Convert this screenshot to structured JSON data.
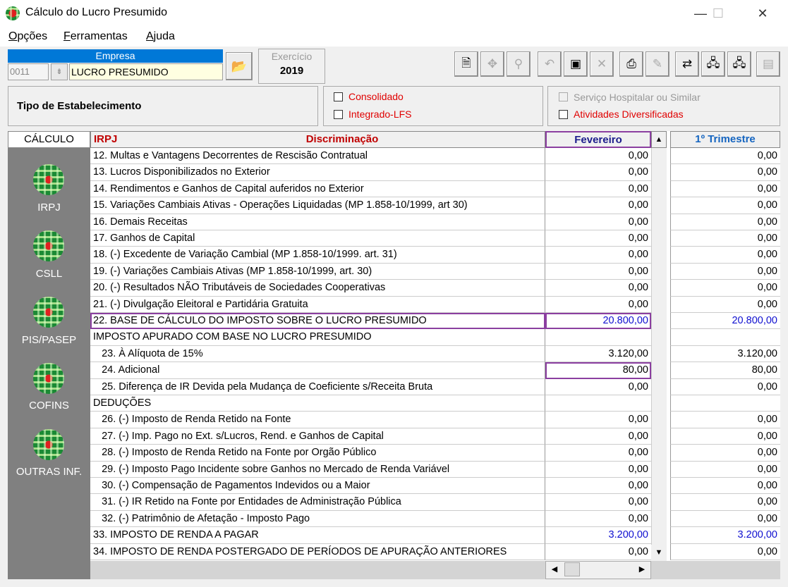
{
  "window": {
    "title": "Cálculo do Lucro Presumido",
    "controls": {
      "minimize": "—",
      "maximize": "☐",
      "close": "✕"
    }
  },
  "menu": [
    {
      "label": "Opções",
      "underline": "O"
    },
    {
      "label": "Ferramentas",
      "underline": "F"
    },
    {
      "label": "Ajuda",
      "underline": "A"
    }
  ],
  "empresa": {
    "label": "Empresa",
    "code": "0011",
    "name": "LUCRO PRESUMIDO"
  },
  "exercicio": {
    "label": "Exercício",
    "year": "2019"
  },
  "toolbar_icons": [
    "document-icon",
    "navigate-icon",
    "search-icon",
    "undo-icon",
    "save-icon",
    "delete-icon",
    "print-icon",
    "tools-icon",
    "import-icon",
    "network-icon",
    "network-config-icon",
    "calculator-icon"
  ],
  "establishment": {
    "label": "Tipo de Estabelecimento",
    "checkboxes": [
      {
        "label": "Consolidado",
        "checked": false,
        "enabled": true
      },
      {
        "label": "Integrado-LFS",
        "checked": false,
        "enabled": true
      },
      {
        "label": "Serviço Hospitalar ou Similar",
        "checked": false,
        "enabled": false
      },
      {
        "label": "Atividades Diversificadas",
        "checked": false,
        "enabled": true
      }
    ]
  },
  "sidebar": {
    "header": "CÁLCULO",
    "items": [
      "IRPJ",
      "CSLL",
      "PIS/PASEP",
      "COFINS",
      "OUTRAS INF."
    ]
  },
  "grid": {
    "headers": {
      "tax": "IRPJ",
      "description": "Discriminação",
      "month": "Fevereiro",
      "quarter": "1º Trimestre"
    },
    "rows": [
      {
        "desc": "12. Multas e Vantagens Decorrentes de Rescisão Contratual",
        "month": "0,00",
        "quarter": "0,00"
      },
      {
        "desc": "13. Lucros Disponibilizados no Exterior",
        "month": "0,00",
        "quarter": "0,00"
      },
      {
        "desc": "14. Rendimentos e Ganhos de Capital auferidos no Exterior",
        "month": "0,00",
        "quarter": "0,00"
      },
      {
        "desc": "15. Variações Cambiais Ativas - Operações Liquidadas (MP 1.858-10/1999, art 30)",
        "month": "0,00",
        "quarter": "0,00"
      },
      {
        "desc": "16. Demais Receitas",
        "month": "0,00",
        "quarter": "0,00"
      },
      {
        "desc": "17. Ganhos de Capital",
        "month": "0,00",
        "quarter": "0,00"
      },
      {
        "desc": "18. (-) Excedente de Variação Cambial (MP 1.858-10/1999. art. 31)",
        "month": "0,00",
        "quarter": "0,00"
      },
      {
        "desc": "19. (-) Variações Cambiais Ativas (MP 1.858-10/1999, art. 30)",
        "month": "0,00",
        "quarter": "0,00"
      },
      {
        "desc": "20. (-) Resultados NÃO Tributáveis de Sociedades Cooperativas",
        "month": "0,00",
        "quarter": "0,00"
      },
      {
        "desc": "21. (-) Divulgação Eleitoral e Partidária Gratuita",
        "month": "0,00",
        "quarter": "0,00"
      },
      {
        "desc": "22. BASE DE CÁLCULO DO IMPOSTO SOBRE O LUCRO PRESUMIDO",
        "month": "20.800,00",
        "quarter": "20.800,00",
        "blue": true,
        "highlight": "row"
      },
      {
        "desc": "IMPOSTO APURADO COM BASE NO LUCRO PRESUMIDO",
        "month": "",
        "quarter": ""
      },
      {
        "desc": "   23. À Alíquota de 15%",
        "month": "3.120,00",
        "quarter": "3.120,00"
      },
      {
        "desc": "   24. Adicional",
        "month": "80,00",
        "quarter": "80,00",
        "highlight": "cell"
      },
      {
        "desc": "   25. Diferença de IR Devida pela Mudança de Coeficiente s/Receita Bruta",
        "month": "0,00",
        "quarter": "0,00"
      },
      {
        "desc": "DEDUÇÕES",
        "month": "",
        "quarter": ""
      },
      {
        "desc": "   26. (-) Imposto de Renda Retido na Fonte",
        "month": "0,00",
        "quarter": "0,00"
      },
      {
        "desc": "   27. (-) Imp. Pago no Ext. s/Lucros, Rend. e Ganhos de Capital",
        "month": "0,00",
        "quarter": "0,00"
      },
      {
        "desc": "   28. (-) Imposto de Renda Retido na Fonte por Orgão Público",
        "month": "0,00",
        "quarter": "0,00"
      },
      {
        "desc": "   29. (-) Imposto Pago Incidente sobre Ganhos no Mercado de Renda Variável",
        "month": "0,00",
        "quarter": "0,00"
      },
      {
        "desc": "   30. (-) Compensação de Pagamentos Indevidos ou a Maior",
        "month": "0,00",
        "quarter": "0,00"
      },
      {
        "desc": "   31. (-) IR Retido na Fonte por Entidades de Administração Pública",
        "month": "0,00",
        "quarter": "0,00"
      },
      {
        "desc": "   32. (-) Patrimônio de Afetação - Imposto Pago",
        "month": "0,00",
        "quarter": "0,00"
      },
      {
        "desc": "33. IMPOSTO DE RENDA A PAGAR",
        "month": "3.200,00",
        "quarter": "3.200,00",
        "blue": true
      },
      {
        "desc": "34. IMPOSTO DE RENDA POSTERGADO DE PERÍODOS DE APURAÇÃO ANTERIORES",
        "month": "0,00",
        "quarter": "0,00"
      }
    ]
  },
  "colors": {
    "title_bg": "#ffffff",
    "empresa_header": "#0078d7",
    "highlight": "#8b3fa0",
    "red_label": "#e00000",
    "blue_value": "#1010d0"
  }
}
